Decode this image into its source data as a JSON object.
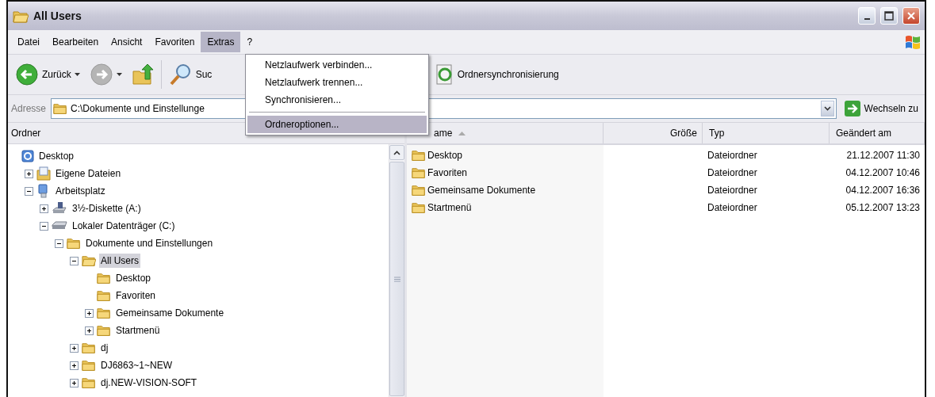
{
  "window": {
    "title": "All Users"
  },
  "menu_bar": [
    {
      "label": "Datei",
      "selected": false
    },
    {
      "label": "Bearbeiten",
      "selected": false
    },
    {
      "label": "Ansicht",
      "selected": false
    },
    {
      "label": "Favoriten",
      "selected": false
    },
    {
      "label": "Extras",
      "selected": true
    },
    {
      "label": "?",
      "selected": false
    }
  ],
  "menu_dropdown": [
    {
      "kind": "item",
      "label": "Netzlaufwerk verbinden...",
      "selected": false
    },
    {
      "kind": "item",
      "label": "Netzlaufwerk trennen...",
      "selected": false
    },
    {
      "kind": "item",
      "label": "Synchronisieren...",
      "selected": false
    },
    {
      "kind": "separator"
    },
    {
      "kind": "item",
      "label": "Ordneroptionen...",
      "selected": true
    }
  ],
  "toolbar": [
    {
      "kind": "back",
      "label": "Zurück",
      "disabled": false
    },
    {
      "kind": "forward",
      "disabled": true
    },
    {
      "kind": "up"
    },
    {
      "kind": "search",
      "label": "Suc"
    },
    {
      "kind": "sync",
      "label": "Ordnersynchronisierung"
    }
  ],
  "address_bar": {
    "label": "Adresse",
    "value": "C:\\Dokumente und Einstellunge",
    "go_button": "Wechseln zu"
  },
  "folder_pane": {
    "title": "Ordner",
    "tree": [
      {
        "label": "Desktop",
        "kind": "desktop",
        "selected": false,
        "children": [
          {
            "label": "Eigene Dateien",
            "kind": "documents",
            "expanded": false,
            "selected": false
          },
          {
            "label": "Arbeitsplatz",
            "kind": "computer",
            "expanded": true,
            "selected": false,
            "children": [
              {
                "label": "3½-Diskette (A:)",
                "kind": "floppy",
                "expanded": false,
                "selected": false
              },
              {
                "label": "Lokaler Datenträger (C:)",
                "kind": "drive",
                "expanded": true,
                "selected": false,
                "children": [
                  {
                    "label": "Dokumente und Einstellungen",
                    "kind": "folder",
                    "expanded": true,
                    "selected": false,
                    "children": [
                      {
                        "label": "All Users",
                        "kind": "folder",
                        "expanded": true,
                        "selected": true,
                        "children": [
                          {
                            "label": "Desktop",
                            "kind": "folder",
                            "selected": false
                          },
                          {
                            "label": "Favoriten",
                            "kind": "folder",
                            "selected": false
                          },
                          {
                            "label": "Gemeinsame Dokumente",
                            "kind": "folder",
                            "expanded": false,
                            "selected": false
                          },
                          {
                            "label": "Startmenü",
                            "kind": "folder",
                            "expanded": false,
                            "selected": false
                          }
                        ]
                      },
                      {
                        "label": "dj",
                        "kind": "folder",
                        "expanded": false,
                        "selected": false
                      },
                      {
                        "label": "DJ6863~1~NEW",
                        "kind": "folder",
                        "expanded": false,
                        "selected": false
                      },
                      {
                        "label": "dj.NEW-VISION-SOFT",
                        "kind": "folder",
                        "expanded": false,
                        "selected": false
                      }
                    ]
                  }
                ]
              }
            ]
          }
        ]
      }
    ]
  },
  "file_list": {
    "columns": [
      {
        "label": "ame",
        "sorted": true
      },
      {
        "label": "Größe",
        "sorted": false
      },
      {
        "label": "Typ",
        "sorted": false
      },
      {
        "label": "Geändert am",
        "sorted": false
      }
    ],
    "rows": [
      {
        "name": "Desktop",
        "type": "Dateiordner",
        "modified": "21.12.2007 11:30"
      },
      {
        "name": "Favoriten",
        "type": "Dateiordner",
        "modified": "04.12.2007 10:46"
      },
      {
        "name": "Gemeinsame Dokumente",
        "type": "Dateiordner",
        "modified": "04.12.2007 16:36"
      },
      {
        "name": "Startmenü",
        "type": "Dateiordner",
        "modified": "05.12.2007 13:23"
      }
    ]
  }
}
